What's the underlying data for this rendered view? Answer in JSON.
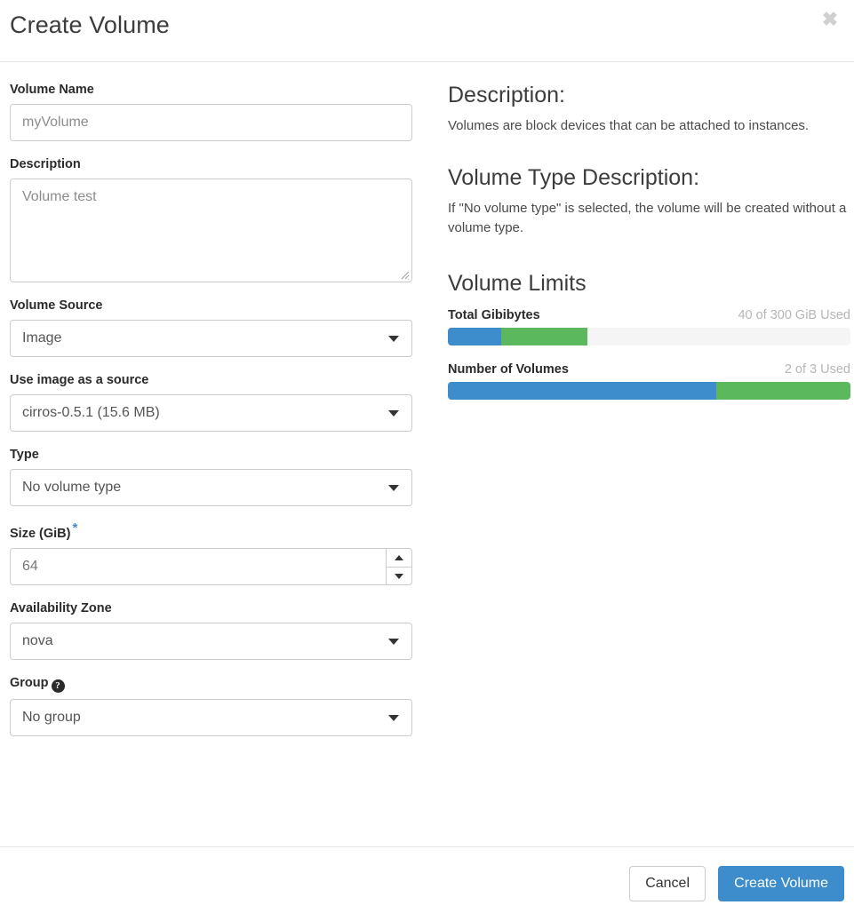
{
  "modal": {
    "title": "Create Volume",
    "close_label": "✖"
  },
  "form": {
    "volume_name": {
      "label": "Volume Name",
      "value": "",
      "placeholder": "myVolume"
    },
    "description": {
      "label": "Description",
      "value": "",
      "placeholder": "Volume test"
    },
    "volume_source": {
      "label": "Volume Source",
      "value": "Image"
    },
    "image_source": {
      "label": "Use image as a source",
      "value": "cirros-0.5.1 (15.6 MB)"
    },
    "type": {
      "label": "Type",
      "value": "No volume type"
    },
    "size": {
      "label": "Size (GiB)",
      "required_marker": "*",
      "value": "64"
    },
    "availability_zone": {
      "label": "Availability Zone",
      "value": "nova"
    },
    "group": {
      "label": "Group",
      "help_marker": "?",
      "value": "No group"
    }
  },
  "info_panel": {
    "description_heading": "Description:",
    "description_text": "Volumes are block devices that can be attached to instances.",
    "volume_type_heading": "Volume Type Description:",
    "volume_type_text": "If \"No volume type\" is selected, the volume will be created without a volume type.",
    "limits_heading": "Volume Limits"
  },
  "limits": [
    {
      "name": "Total Gibibytes",
      "used_text": "40 of 300 GiB Used",
      "used": 40,
      "adding": 64,
      "total": 300,
      "used_pct": 13.3,
      "adding_pct": 21.4
    },
    {
      "name": "Number of Volumes",
      "used_text": "2 of 3 Used",
      "used": 2,
      "adding": 1,
      "total": 3,
      "used_pct": 66.7,
      "adding_pct": 33.3
    }
  ],
  "footer": {
    "cancel_label": "Cancel",
    "submit_label": "Create Volume"
  },
  "colors": {
    "used_bar": "#3d8ccc",
    "adding_bar": "#5cb85c",
    "track": "#f5f5f5",
    "primary_button": "#3d8ccc",
    "required_star": "#4c87c5"
  }
}
